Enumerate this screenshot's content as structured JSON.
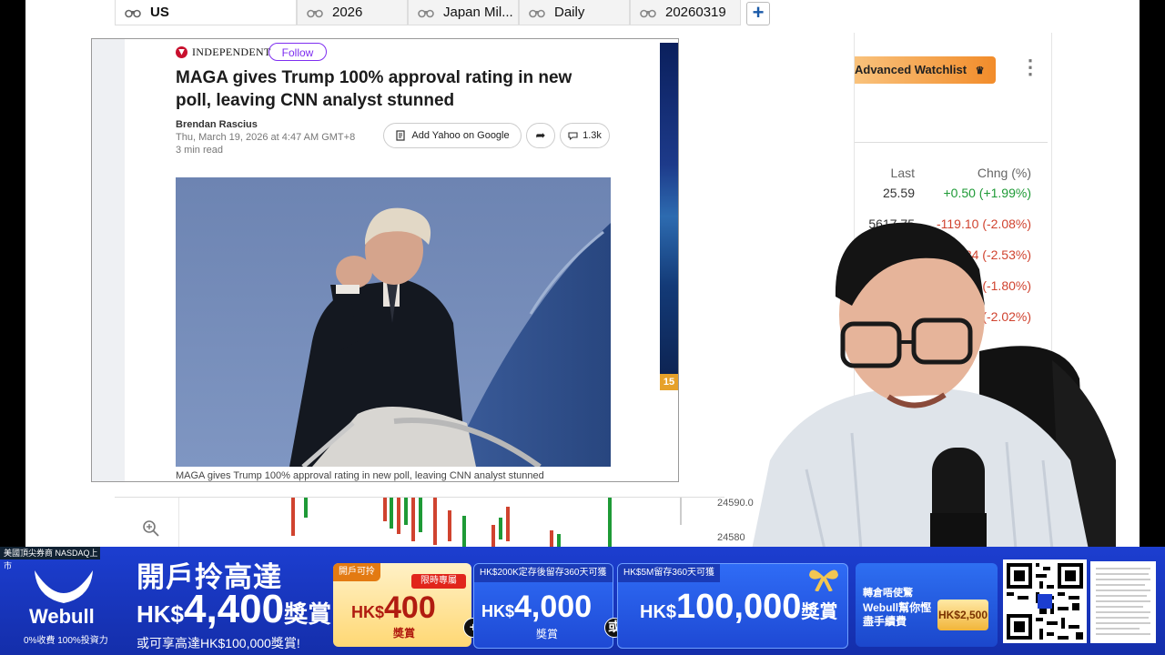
{
  "tabs": [
    {
      "label": "US",
      "active": true
    },
    {
      "label": "2026",
      "active": false
    },
    {
      "label": "Japan Mil...",
      "active": false
    },
    {
      "label": "Daily",
      "active": false
    },
    {
      "label": "20260319",
      "active": false
    }
  ],
  "tab_add_label": "+",
  "watchlist": {
    "advanced_button": "Advanced Watchlist",
    "menu_icon": "more-vertical-icon",
    "columns": {
      "last": "Last",
      "chng": "Chng (%)"
    },
    "rows": [
      {
        "last": "25.59",
        "chng": "+0.50 (+1.99%)",
        "dir": "up"
      },
      {
        "last": "5617.75",
        "chng": "-119.10 (-2.08%)",
        "dir": "down"
      },
      {
        "last": "",
        "chng": "5.84 (-2.53%)",
        "dir": "down"
      },
      {
        "last": "",
        "chng": "4 (-1.80%)",
        "dir": "down"
      },
      {
        "last": "",
        "chng": "(-2.02%)",
        "dir": "down"
      }
    ]
  },
  "chart": {
    "price_labels": [
      "24590.0",
      "24580"
    ]
  },
  "article": {
    "publisher": "INDEPENDENT",
    "follow_label": "Follow",
    "headline": "MAGA gives Trump 100% approval rating in new poll, leaving CNN analyst stunned",
    "author": "Brendan Rascius",
    "date": "Thu, March 19, 2026 at 4:47 AM GMT+8",
    "read_time": "3 min read",
    "add_yahoo_label": "Add Yahoo on Google",
    "comments_count": "1.3k",
    "caption": "MAGA gives Trump 100% approval rating in new poll, leaving CNN analyst stunned",
    "ad_badge": "15"
  },
  "banner": {
    "top_line": "美國頂尖券商 NASDAQ上市",
    "brand": "Webull",
    "brand_sub": "0%收費 100%投資力",
    "title": "開戶拎高達",
    "amount_prefix": "HK$",
    "amount": "4,400",
    "amount_suffix": "獎賞",
    "sub": "或可享高達HK$100,000獎賞!",
    "card1": {
      "header": "開戶可拎",
      "badge": "限時專屬",
      "prefix": "HK$",
      "value": "400",
      "unit": "獎賞"
    },
    "card2": {
      "header": "HK$200K定存後留存360天可獲",
      "prefix": "HK$",
      "value": "4,000",
      "unit": "獎賞"
    },
    "card3": {
      "header": "HK$5M留存360天可獲",
      "prefix": "HK$",
      "value": "100,000",
      "unit": "獎賞"
    },
    "plus_symbol": "+",
    "or_symbol": "或",
    "card4": {
      "header": "轉倉唔使驚",
      "text": "Webull幫你慳盡手續費",
      "badge": "HK$2,500"
    }
  },
  "colors": {
    "up": "#1e9a36",
    "down": "#d0432f",
    "banner_blue": "#1c3ed0",
    "follow_purple": "#7e2ef0"
  }
}
